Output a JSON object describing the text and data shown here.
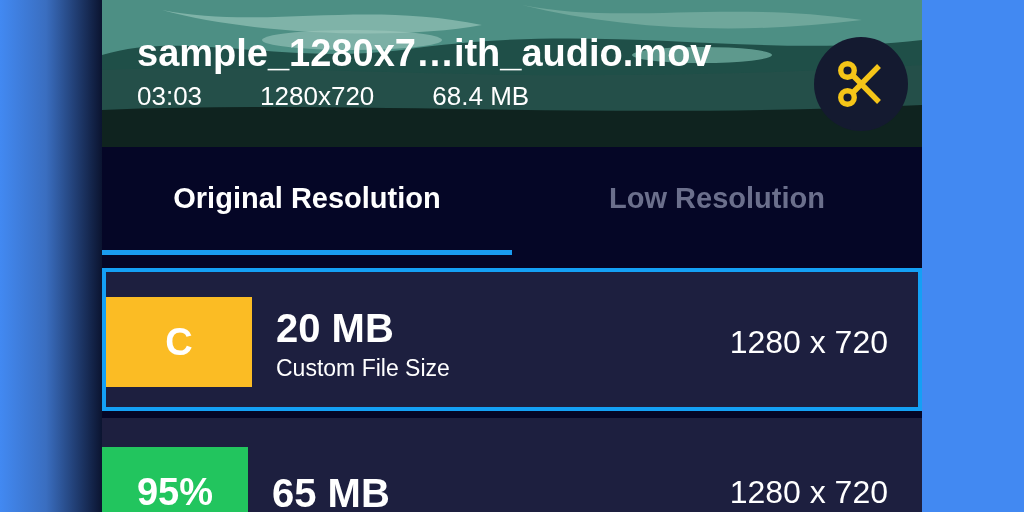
{
  "video": {
    "title": "sample_1280x7…ith_audio.mov",
    "duration": "03:03",
    "resolution": "1280x720",
    "size": "68.4 MB"
  },
  "tabs": [
    {
      "label": "Original Resolution",
      "selected": true
    },
    {
      "label": "Low Resolution",
      "selected": false
    }
  ],
  "options": [
    {
      "badge": "C",
      "color": "#fbbc24",
      "size": "20 MB",
      "subtitle": "Custom File Size",
      "resolution": "1280 x 720",
      "selected": true
    },
    {
      "badge": "95%",
      "color": "#22c55e",
      "size": "65 MB",
      "resolution": "1280 x 720",
      "selected": false
    }
  ]
}
